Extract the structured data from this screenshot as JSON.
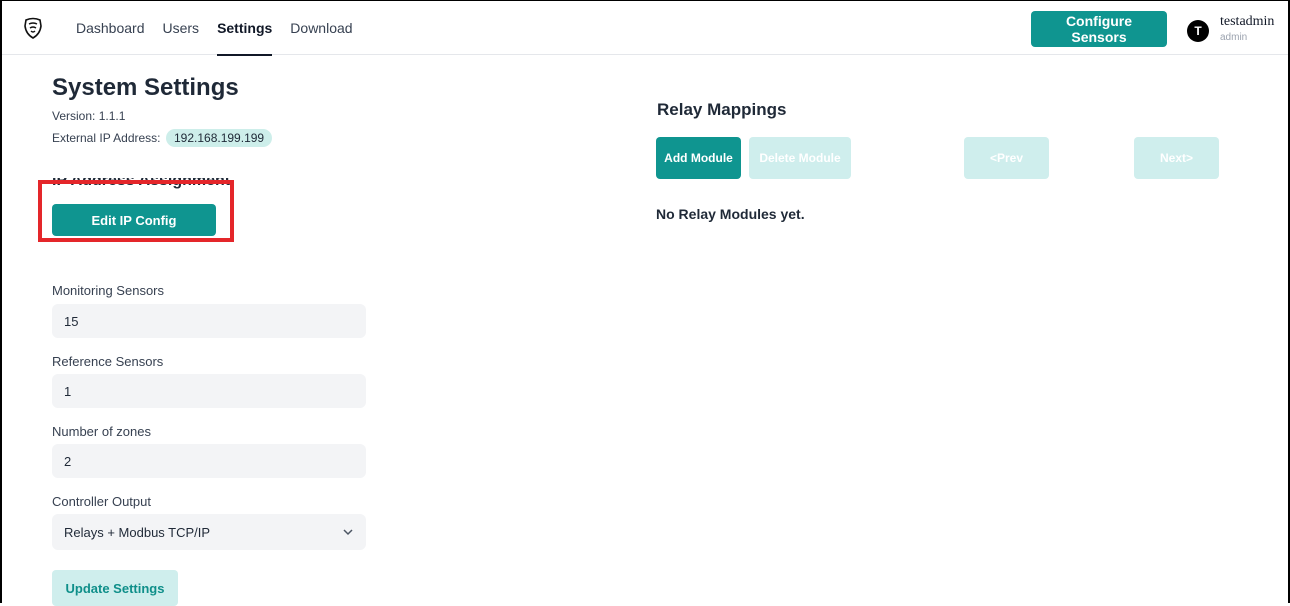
{
  "header": {
    "nav": [
      "Dashboard",
      "Users",
      "Settings",
      "Download"
    ],
    "active_nav": "Settings",
    "configure_button": "Configure Sensors",
    "user": {
      "initial": "T",
      "name": "testadmin",
      "role": "admin"
    }
  },
  "settings": {
    "title": "System Settings",
    "version": "Version: 1.1.1",
    "external_ip_label": "External IP Address:",
    "external_ip": "192.168.199.199",
    "ip_assignment_label": "IP Address Assignment",
    "edit_ip_button": "Edit IP Config",
    "fields": [
      {
        "label": "Monitoring Sensors",
        "value": "15"
      },
      {
        "label": "Reference Sensors",
        "value": "1"
      },
      {
        "label": "Number of zones",
        "value": "2"
      }
    ],
    "controller_output_label": "Controller Output",
    "controller_output_value": "Relays + Modbus TCP/IP",
    "update_button": "Update Settings"
  },
  "relay": {
    "title": "Relay Mappings",
    "add_module": "Add Module",
    "delete_module": "Delete Module",
    "prev": "<Prev",
    "next": "Next>",
    "empty_text": "No Relay Modules yet."
  },
  "colors": {
    "accent": "#0f9590",
    "accent_light": "#cfeeed",
    "highlight": "#e4262a"
  }
}
